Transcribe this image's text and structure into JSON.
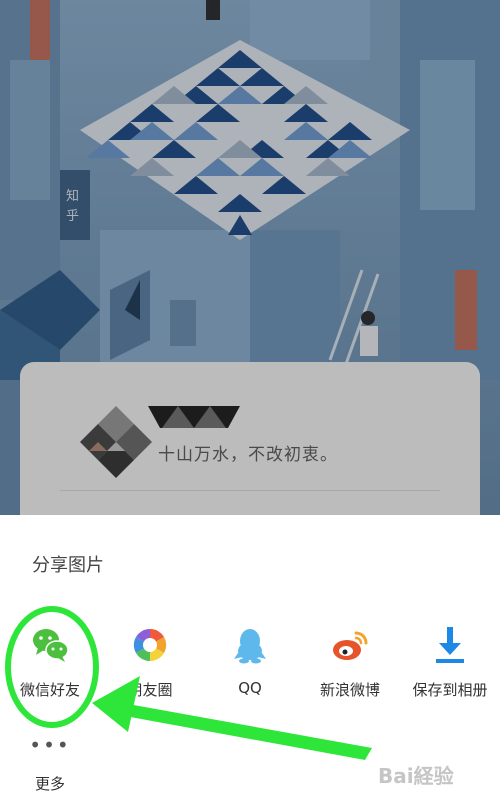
{
  "card": {
    "motto": "十山万水，不改初衷。"
  },
  "share_sheet": {
    "title": "分享图片",
    "items": [
      {
        "label": "微信好友",
        "icon": "wechat-icon",
        "color": "#4cbf3f"
      },
      {
        "label": "朋友圈",
        "icon": "moments-icon",
        "color": "#f07a2d"
      },
      {
        "label": "QQ",
        "icon": "qq-icon",
        "color": "#5fb8ec"
      },
      {
        "label": "新浪微博",
        "icon": "weibo-icon",
        "color": "#e6542c"
      },
      {
        "label": "保存到相册",
        "icon": "download-icon",
        "color": "#1e88e5"
      }
    ],
    "more": {
      "label": "更多",
      "icon": "more-dots-icon",
      "glyph": "•••"
    }
  },
  "annotation": {
    "color": "#2ee63a"
  },
  "watermark": {
    "text": "Bai経验"
  }
}
